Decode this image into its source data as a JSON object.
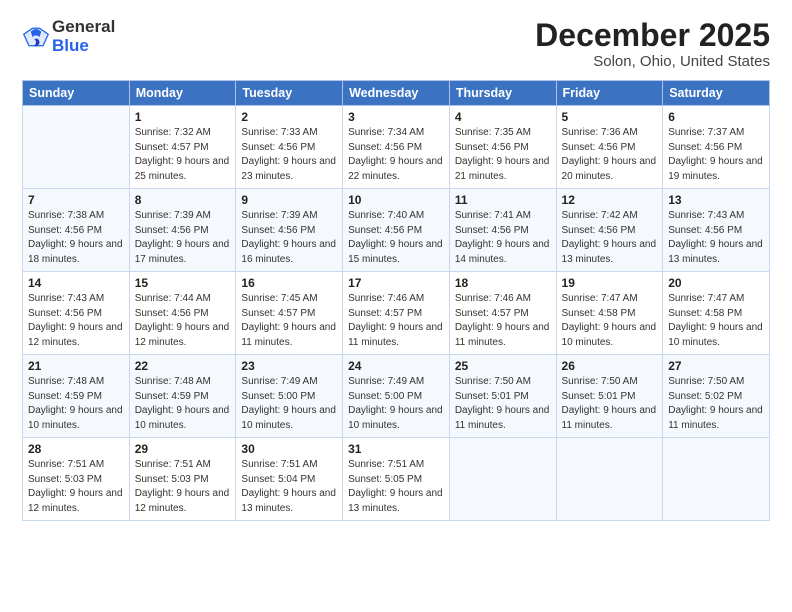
{
  "logo": {
    "general": "General",
    "blue": "Blue"
  },
  "title": "December 2025",
  "subtitle": "Solon, Ohio, United States",
  "days_of_week": [
    "Sunday",
    "Monday",
    "Tuesday",
    "Wednesday",
    "Thursday",
    "Friday",
    "Saturday"
  ],
  "weeks": [
    [
      {
        "day": "",
        "detail": ""
      },
      {
        "day": "1",
        "detail": "Sunrise: 7:32 AM\nSunset: 4:57 PM\nDaylight: 9 hours\nand 25 minutes."
      },
      {
        "day": "2",
        "detail": "Sunrise: 7:33 AM\nSunset: 4:56 PM\nDaylight: 9 hours\nand 23 minutes."
      },
      {
        "day": "3",
        "detail": "Sunrise: 7:34 AM\nSunset: 4:56 PM\nDaylight: 9 hours\nand 22 minutes."
      },
      {
        "day": "4",
        "detail": "Sunrise: 7:35 AM\nSunset: 4:56 PM\nDaylight: 9 hours\nand 21 minutes."
      },
      {
        "day": "5",
        "detail": "Sunrise: 7:36 AM\nSunset: 4:56 PM\nDaylight: 9 hours\nand 20 minutes."
      },
      {
        "day": "6",
        "detail": "Sunrise: 7:37 AM\nSunset: 4:56 PM\nDaylight: 9 hours\nand 19 minutes."
      }
    ],
    [
      {
        "day": "7",
        "detail": "Sunrise: 7:38 AM\nSunset: 4:56 PM\nDaylight: 9 hours\nand 18 minutes."
      },
      {
        "day": "8",
        "detail": "Sunrise: 7:39 AM\nSunset: 4:56 PM\nDaylight: 9 hours\nand 17 minutes."
      },
      {
        "day": "9",
        "detail": "Sunrise: 7:39 AM\nSunset: 4:56 PM\nDaylight: 9 hours\nand 16 minutes."
      },
      {
        "day": "10",
        "detail": "Sunrise: 7:40 AM\nSunset: 4:56 PM\nDaylight: 9 hours\nand 15 minutes."
      },
      {
        "day": "11",
        "detail": "Sunrise: 7:41 AM\nSunset: 4:56 PM\nDaylight: 9 hours\nand 14 minutes."
      },
      {
        "day": "12",
        "detail": "Sunrise: 7:42 AM\nSunset: 4:56 PM\nDaylight: 9 hours\nand 13 minutes."
      },
      {
        "day": "13",
        "detail": "Sunrise: 7:43 AM\nSunset: 4:56 PM\nDaylight: 9 hours\nand 13 minutes."
      }
    ],
    [
      {
        "day": "14",
        "detail": "Sunrise: 7:43 AM\nSunset: 4:56 PM\nDaylight: 9 hours\nand 12 minutes."
      },
      {
        "day": "15",
        "detail": "Sunrise: 7:44 AM\nSunset: 4:56 PM\nDaylight: 9 hours\nand 12 minutes."
      },
      {
        "day": "16",
        "detail": "Sunrise: 7:45 AM\nSunset: 4:57 PM\nDaylight: 9 hours\nand 11 minutes."
      },
      {
        "day": "17",
        "detail": "Sunrise: 7:46 AM\nSunset: 4:57 PM\nDaylight: 9 hours\nand 11 minutes."
      },
      {
        "day": "18",
        "detail": "Sunrise: 7:46 AM\nSunset: 4:57 PM\nDaylight: 9 hours\nand 11 minutes."
      },
      {
        "day": "19",
        "detail": "Sunrise: 7:47 AM\nSunset: 4:58 PM\nDaylight: 9 hours\nand 10 minutes."
      },
      {
        "day": "20",
        "detail": "Sunrise: 7:47 AM\nSunset: 4:58 PM\nDaylight: 9 hours\nand 10 minutes."
      }
    ],
    [
      {
        "day": "21",
        "detail": "Sunrise: 7:48 AM\nSunset: 4:59 PM\nDaylight: 9 hours\nand 10 minutes."
      },
      {
        "day": "22",
        "detail": "Sunrise: 7:48 AM\nSunset: 4:59 PM\nDaylight: 9 hours\nand 10 minutes."
      },
      {
        "day": "23",
        "detail": "Sunrise: 7:49 AM\nSunset: 5:00 PM\nDaylight: 9 hours\nand 10 minutes."
      },
      {
        "day": "24",
        "detail": "Sunrise: 7:49 AM\nSunset: 5:00 PM\nDaylight: 9 hours\nand 10 minutes."
      },
      {
        "day": "25",
        "detail": "Sunrise: 7:50 AM\nSunset: 5:01 PM\nDaylight: 9 hours\nand 11 minutes."
      },
      {
        "day": "26",
        "detail": "Sunrise: 7:50 AM\nSunset: 5:01 PM\nDaylight: 9 hours\nand 11 minutes."
      },
      {
        "day": "27",
        "detail": "Sunrise: 7:50 AM\nSunset: 5:02 PM\nDaylight: 9 hours\nand 11 minutes."
      }
    ],
    [
      {
        "day": "28",
        "detail": "Sunrise: 7:51 AM\nSunset: 5:03 PM\nDaylight: 9 hours\nand 12 minutes."
      },
      {
        "day": "29",
        "detail": "Sunrise: 7:51 AM\nSunset: 5:03 PM\nDaylight: 9 hours\nand 12 minutes."
      },
      {
        "day": "30",
        "detail": "Sunrise: 7:51 AM\nSunset: 5:04 PM\nDaylight: 9 hours\nand 13 minutes."
      },
      {
        "day": "31",
        "detail": "Sunrise: 7:51 AM\nSunset: 5:05 PM\nDaylight: 9 hours\nand 13 minutes."
      },
      {
        "day": "",
        "detail": ""
      },
      {
        "day": "",
        "detail": ""
      },
      {
        "day": "",
        "detail": ""
      }
    ]
  ]
}
